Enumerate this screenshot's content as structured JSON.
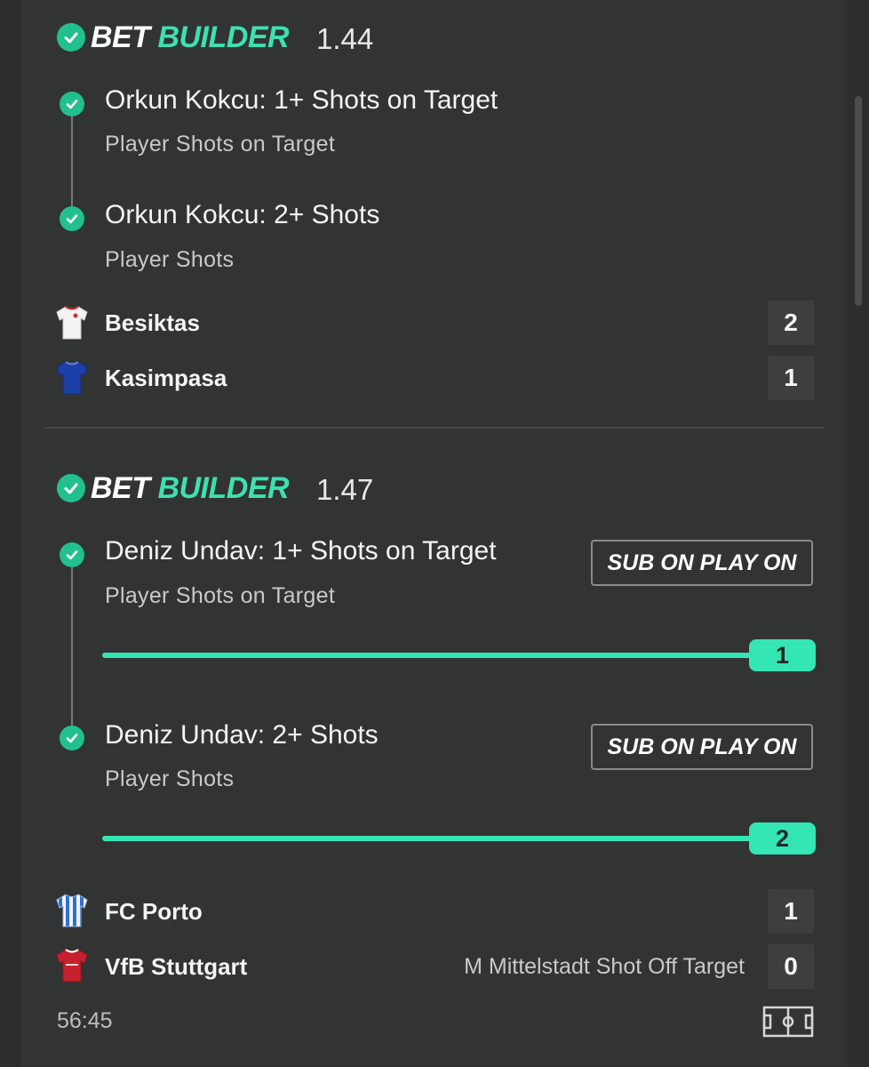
{
  "builders": [
    {
      "title_part1": "BET",
      "title_part2": "BUILDER",
      "odds": "1.44",
      "legs": [
        {
          "title": "Orkun Kokcu: 1+ Shots on Target",
          "subtitle": "Player Shots on Target"
        },
        {
          "title": "Orkun Kokcu: 2+ Shots",
          "subtitle": "Player Shots"
        }
      ],
      "teams": [
        {
          "name": "Besiktas",
          "score": "2",
          "shirt_icon": "white-red-shirt-icon"
        },
        {
          "name": "Kasimpasa",
          "score": "1",
          "shirt_icon": "blue-shirt-icon"
        }
      ]
    },
    {
      "title_part1": "BET",
      "title_part2": "BUILDER",
      "odds": "1.47",
      "legs": [
        {
          "title": "Deniz Undav: 1+ Shots on Target",
          "subtitle": "Player Shots on Target",
          "button": "SUB ON PLAY ON",
          "progress_value": "1",
          "progress_fraction": 1.0
        },
        {
          "title": "Deniz Undav: 2+ Shots",
          "subtitle": "Player Shots",
          "button": "SUB ON PLAY ON",
          "progress_value": "2",
          "progress_fraction": 1.0
        }
      ],
      "teams": [
        {
          "name": "FC Porto",
          "score": "1",
          "shirt_icon": "blue-white-striped-shirt-icon"
        },
        {
          "name": "VfB Stuttgart",
          "score": "0",
          "shirt_icon": "red-shirt-icon",
          "event": "M Mittelstadt Shot Off Target"
        }
      ]
    }
  ],
  "match_clock": "56:45",
  "colors": {
    "accent": "#33e6b4",
    "check": "#22c08e",
    "background": "#323433"
  }
}
